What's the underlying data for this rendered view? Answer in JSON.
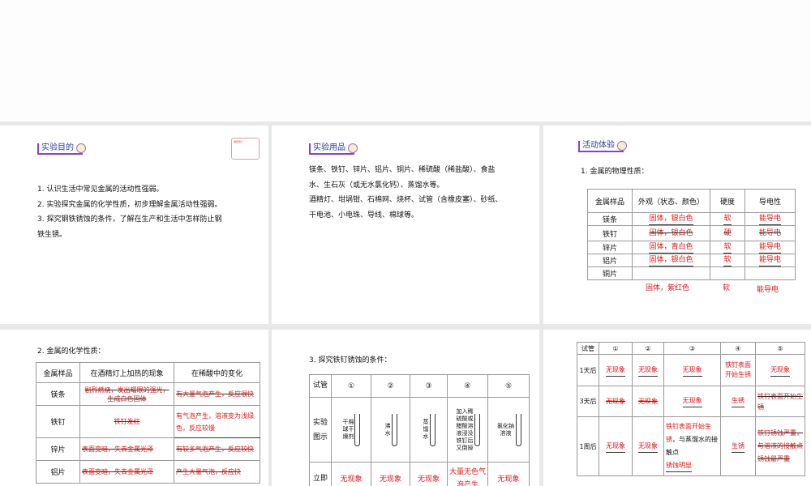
{
  "slides": [
    {
      "heading": "实验目的",
      "stamp": "课题简介",
      "lines": [
        "1. 认识生活中常见金属的活动性强弱。",
        "2. 实验探究金属的化学性质，初步理解金属活动性强弱。",
        "3. 探究钢铁锈蚀的条件，了解在生产和生活中怎样防止钢",
        "铁生锈。"
      ]
    },
    {
      "heading": "实验用品",
      "lines": [
        "镁条、铁钉、锌片、铝片、铜片、稀硫酸（稀盐酸）、食盐",
        "水、生石灰（或无水氯化钙）、蒸馏水等。",
        "酒精灯、坩埚钳、石棉网、烧杯、试管（含橡皮塞）、砂纸、",
        "干电池、小电珠、导线、棉球等。"
      ]
    },
    {
      "heading": "活动体验",
      "subtitle": "1. 金属的物理性质：",
      "headers": [
        "金属样品",
        "外观（状态、颜色）",
        "硬度",
        "导电性"
      ],
      "rows": [
        [
          "镁条",
          "固体，银白色",
          "软",
          "能导电"
        ],
        [
          "铁钉",
          "固体，银白色",
          "硬",
          "能导电"
        ],
        [
          "锌片",
          "固体，青白色",
          "软",
          "能导电"
        ],
        [
          "铝片",
          "固体，银白色",
          "软",
          "能导电"
        ],
        [
          "铜片",
          "固体，紫红色",
          "软",
          "能导电"
        ]
      ]
    },
    {
      "subtitle": "2. 金属的化学性质：",
      "headers": [
        "金属样品",
        "在酒精灯上加热的现象",
        "在稀酸中的变化"
      ],
      "rows": [
        [
          "镁条",
          "剧烈燃烧，发出耀眼的强光，生成白色固体",
          "有大量气泡产生，反应很快"
        ],
        [
          "铁钉",
          "铁钉发红",
          "有气泡产生，溶液变为浅绿色，反应较慢"
        ],
        [
          "锌片",
          "表面变暗，失去金属光泽",
          "有较多气泡产生，反应较快"
        ],
        [
          "铝片",
          "表面变暗，失去金属光泽",
          "产生大量气泡，反应快"
        ]
      ]
    },
    {
      "subtitle": "3. 探究铁钉锈蚀的条件：",
      "headers": [
        "试管",
        "①",
        "②",
        "③",
        "④",
        "⑤"
      ],
      "row2_label": "实验图示",
      "row3_label": "立即",
      "tube_labels": [
        "干棉球干燥剂",
        "沸水",
        "蒸馏水",
        "加入稀硫酸或醋酸溶液浸没铁钉后又倒掉",
        "氯化钠溶液"
      ],
      "immediate": [
        "无现象",
        "无现象",
        "无现象",
        "大量无色气泡产生",
        "无现象"
      ]
    },
    {
      "headers": [
        "试管",
        "①",
        "②",
        "③",
        "④",
        "⑤"
      ],
      "rows": [
        {
          "label": "1天后",
          "cells": [
            "无现象",
            "无现象",
            "无现象",
            "铁钉表面开始生锈",
            "无现象"
          ]
        },
        {
          "label": "3天后",
          "cells": [
            "无现象",
            "无现象",
            "无现象",
            "生锈",
            "铁钉表面开始生锈"
          ]
        },
        {
          "label": "1周后",
          "cells": [
            "无现象",
            "无现象",
            "铁钉表面开始生锈",
            "生锈",
            "铁钉锈蚀严重，与溶液的接触点锈蚀最严重"
          ],
          "extra": "，与蒸馏水的接触点",
          "extra2": "锈蚀明显"
        }
      ]
    }
  ]
}
